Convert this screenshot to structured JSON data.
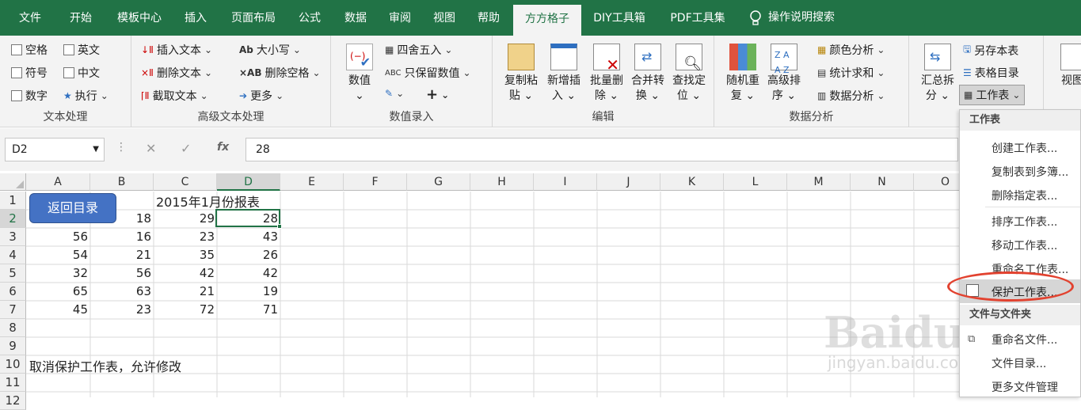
{
  "tabs": [
    "文件",
    "开始",
    "模板中心",
    "插入",
    "页面布局",
    "公式",
    "数据",
    "审阅",
    "视图",
    "帮助",
    "方方格子",
    "DIY工具箱",
    "PDF工具集",
    "操作说明搜索"
  ],
  "text_proc": {
    "opts": [
      "空格",
      "英文",
      "符号",
      "中文",
      "数字",
      "执行"
    ],
    "label": "文本处理"
  },
  "adv_text": {
    "items": [
      "插入文本",
      "删除文本",
      "截取文本",
      "大小写",
      "删除空格",
      "更多"
    ],
    "label": "高级文本处理"
  },
  "value_input": {
    "big": "数值",
    "items": [
      "四舍五入",
      "只保留数值"
    ],
    "label": "数值录入"
  },
  "edit": {
    "buttons": [
      [
        "复制粘",
        "贴"
      ],
      [
        "新增插",
        "入"
      ],
      [
        "批量删",
        "除"
      ],
      [
        "合并转",
        "换"
      ],
      [
        "查找定",
        "位"
      ]
    ],
    "label": "编辑"
  },
  "analysis": {
    "buttons": [
      [
        "随机重",
        "复"
      ],
      [
        "高级排",
        "序"
      ]
    ],
    "items": [
      "颜色分析",
      "统计求和",
      "数据分析"
    ],
    "label": "数据分析"
  },
  "summary": {
    "big": [
      "汇总拆",
      "分"
    ],
    "items": [
      "另存本表",
      "表格目录",
      "工作表"
    ],
    "view": "视图"
  },
  "formula_bar": {
    "name_box": "D2",
    "fx": "fx",
    "value": "28"
  },
  "columns": [
    "A",
    "B",
    "C",
    "D",
    "E",
    "F",
    "G",
    "H",
    "I",
    "J",
    "K",
    "L",
    "M",
    "N",
    "O"
  ],
  "rows": [
    "1",
    "2",
    "3",
    "4",
    "5",
    "6",
    "7",
    "8",
    "9",
    "10",
    "11",
    "12"
  ],
  "sheet": {
    "title": "2015年1月份报表",
    "back_button": "返回目录",
    "data": [
      [
        "",
        "18",
        "29",
        "28"
      ],
      [
        "56",
        "16",
        "23",
        "43"
      ],
      [
        "54",
        "21",
        "35",
        "26"
      ],
      [
        "32",
        "56",
        "42",
        "42"
      ],
      [
        "65",
        "63",
        "21",
        "19"
      ],
      [
        "45",
        "23",
        "72",
        "71"
      ]
    ],
    "note": "取消保护工作表，允许修改"
  },
  "menu": {
    "header1": "工作表",
    "items1": [
      "创建工作表...",
      "复制表到多簿...",
      "删除指定表...",
      "排序工作表...",
      "移动工作表...",
      "重命名工作表...",
      "保护工作表..."
    ],
    "header2": "文件与文件夹",
    "items2": [
      "重命名文件...",
      "文件目录...",
      "更多文件管理"
    ]
  },
  "watermark": {
    "brand": "Baidu经验",
    "url": "jingyan.baidu.com"
  },
  "colors": {
    "green": "#217346",
    "highlight": "#e2422f",
    "button": "#4472c4"
  }
}
